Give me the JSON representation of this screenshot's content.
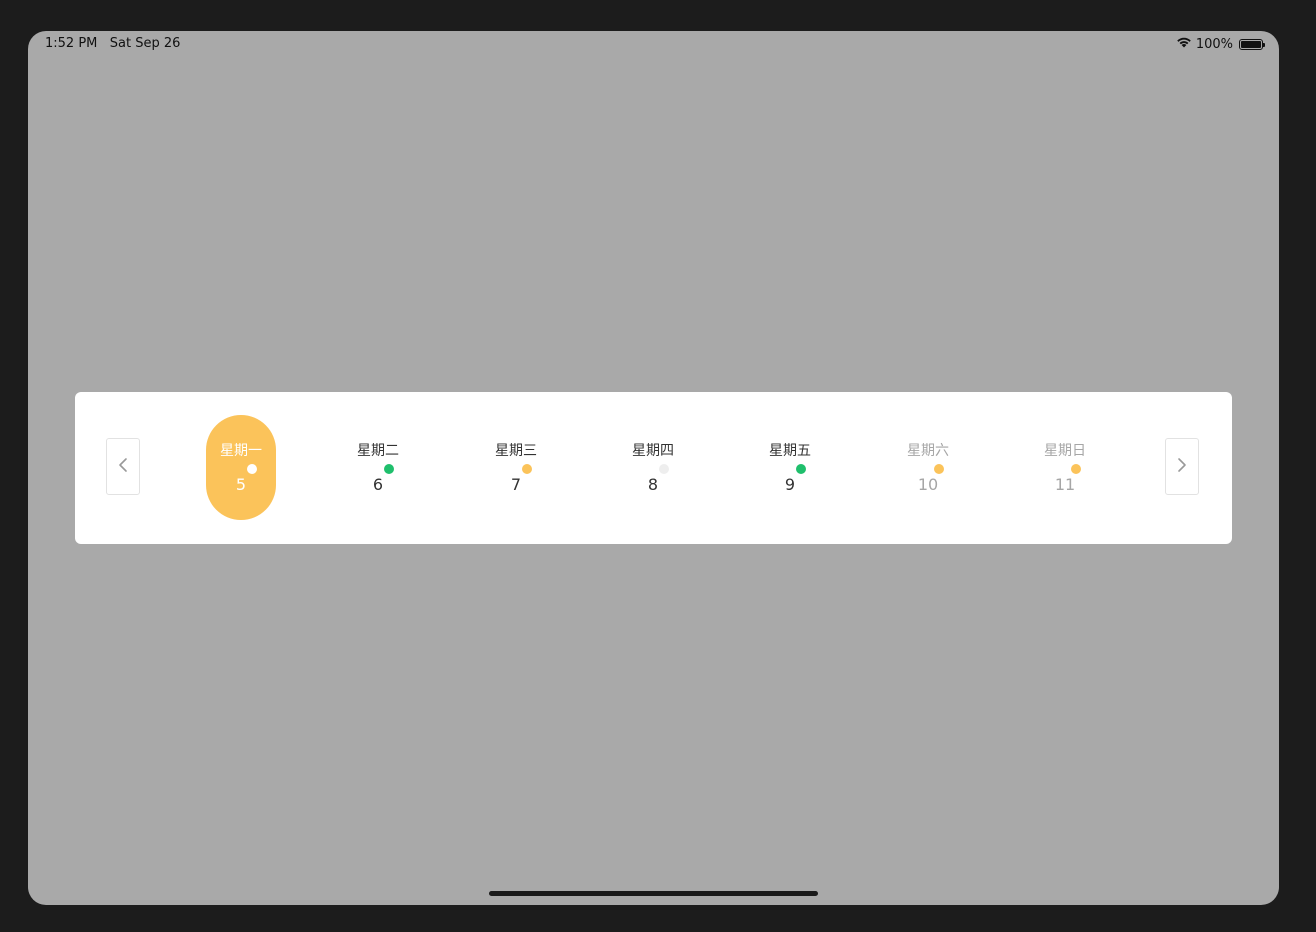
{
  "status_bar": {
    "time": "1:52 PM",
    "date": "Sat Sep 26",
    "battery_percent": "100%",
    "wifi_icon": "wifi-icon",
    "battery_icon": "battery-icon"
  },
  "calendar": {
    "prev_icon": "chevron-left-icon",
    "next_icon": "chevron-right-icon",
    "days": [
      {
        "label": "星期一",
        "date": "5",
        "dot_color": "#ffffff",
        "selected": true
      },
      {
        "label": "星期二",
        "date": "6",
        "dot_color": "#1fbf6c"
      },
      {
        "label": "星期三",
        "date": "7",
        "dot_color": "#fbc35a"
      },
      {
        "label": "星期四",
        "date": "8",
        "dot_color": "#eeeeee"
      },
      {
        "label": "星期五",
        "date": "9",
        "dot_color": "#1fbf6c"
      },
      {
        "label": "星期六",
        "date": "10",
        "dot_color": "#fbc35a"
      },
      {
        "label": "星期日",
        "date": "11",
        "dot_color": "#fbc35a"
      }
    ]
  },
  "colors": {
    "accent": "#fbc35a",
    "green": "#1fbf6c",
    "screen_background": "#a9a9a9",
    "card_background": "#ffffff"
  }
}
